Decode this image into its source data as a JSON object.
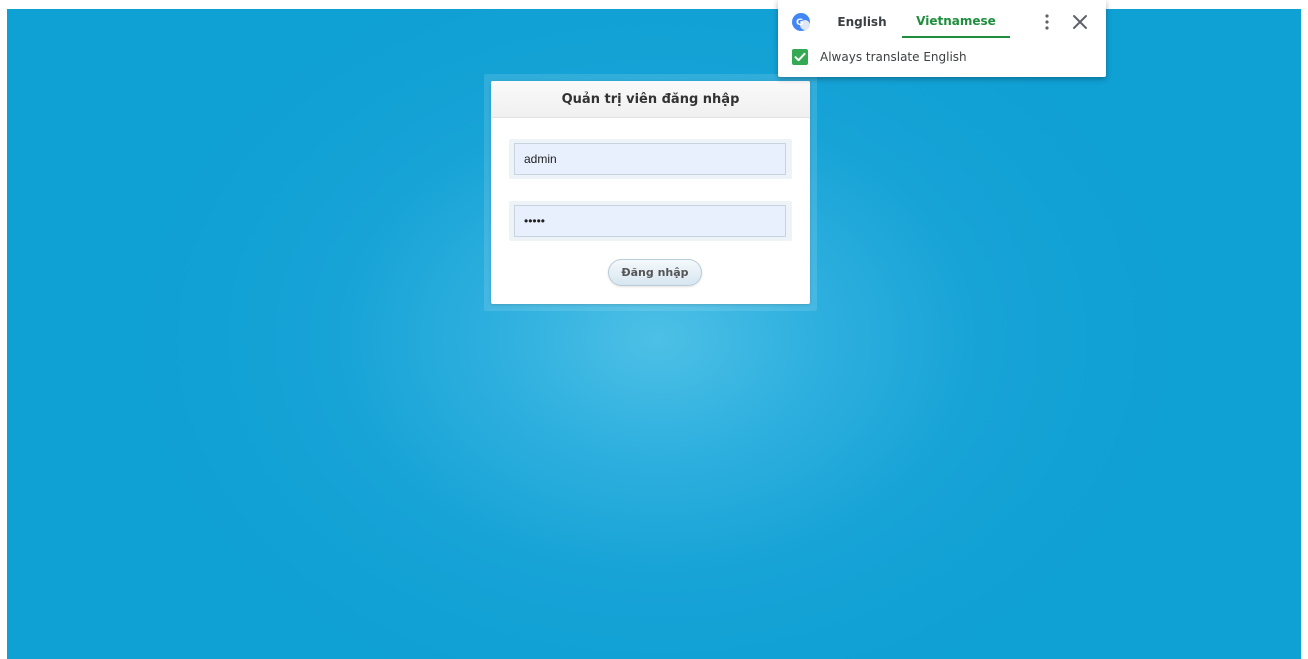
{
  "login": {
    "title": "Quản trị viên đăng nhập",
    "username_value": "admin",
    "password_value": "•••••",
    "submit_label": "Đăng nhập"
  },
  "translate_bar": {
    "source_tab": "English",
    "target_tab": "Vietnamese",
    "active_tab": "Vietnamese",
    "always_translate_label": "Always translate English",
    "always_translate_checked": true,
    "accent_color": "#1e8e3e",
    "checkbox_color": "#34a853"
  },
  "icons": {
    "translate": "google-translate-icon",
    "menu": "more-vert-icon",
    "close": "close-icon",
    "check": "checkmark-icon"
  },
  "colors": {
    "background": "#0fa0d4",
    "background_center": "#4dc0e6"
  }
}
